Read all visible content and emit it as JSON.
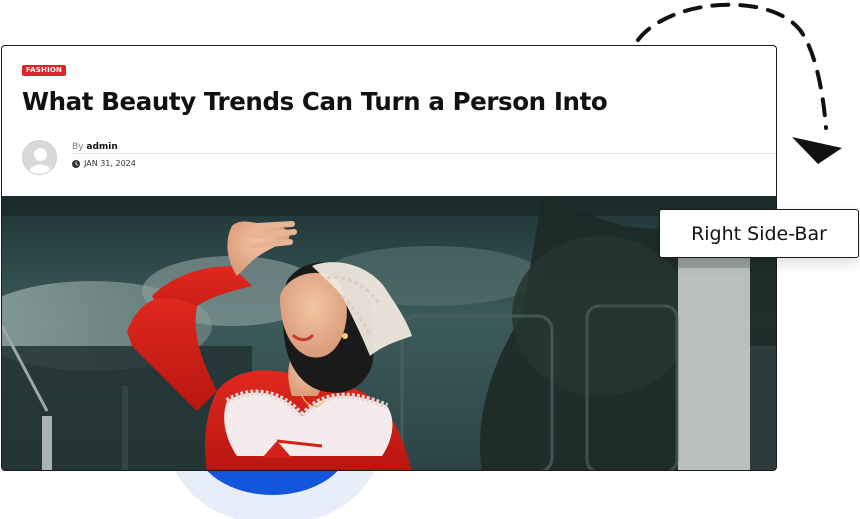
{
  "post": {
    "category": "FASHION",
    "title": "What Beauty Trends Can Turn a Person Into",
    "by_prefix": "By",
    "author": "admin",
    "date": "JAN 31, 2024"
  },
  "annotation": {
    "label": "Right Side-Bar"
  },
  "hero": {
    "subject": "woman in red dress with lace headscarf shading eyes"
  },
  "colors": {
    "accent_red": "#e0242c",
    "title_text": "#111111",
    "decor_blue": "#1456db"
  },
  "icons": {
    "avatar": "user-avatar-icon",
    "date": "clock-icon",
    "arrow": "dashed-curved-arrow-icon"
  }
}
